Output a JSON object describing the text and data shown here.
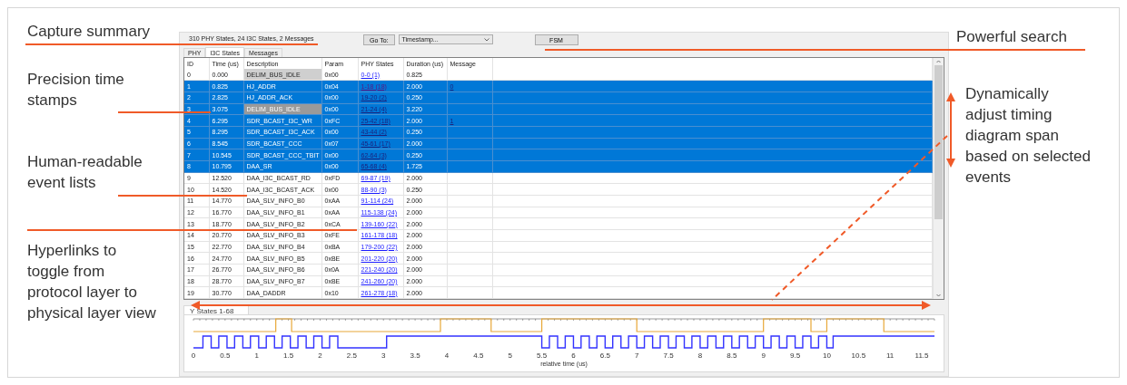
{
  "left_notes": [
    "Capture summary",
    "Precision time stamps",
    "Human-readable event lists",
    "Hyperlinks to toggle from protocol layer to physical layer view"
  ],
  "right_notes": [
    "Powerful search",
    "Dynamically adjust timing diagram span based on selected events"
  ],
  "summary": "310 PHY States, 24 I3C States, 2 Messages",
  "goto_button": "Go To:",
  "search_select": {
    "value": "Timestamp..."
  },
  "fsm_button": "FSM",
  "tabs": [
    {
      "label": "PHY",
      "selected": false
    },
    {
      "label": "I3C States",
      "selected": true
    },
    {
      "label": "Messages",
      "selected": false
    }
  ],
  "table": {
    "columns": [
      "ID",
      "Time (us)",
      "Description",
      "Param",
      "PHY States",
      "Duration (us)",
      "Message"
    ],
    "rows": [
      {
        "id": "0",
        "time": "0.000",
        "description": "DELIM_BUS_IDLE",
        "param": "0x00",
        "phy_states": "0-0 (1)",
        "duration": "0.825",
        "message": "",
        "selected": false,
        "focused": true,
        "visited": false
      },
      {
        "id": "1",
        "time": "0.825",
        "description": "HJ_ADDR",
        "param": "0x04",
        "phy_states": "1-18 (18)",
        "duration": "2.000",
        "message": "0",
        "selected": true,
        "focused": false,
        "visited": true
      },
      {
        "id": "2",
        "time": "2.825",
        "description": "HJ_ADDR_ACK",
        "param": "0x00",
        "phy_states": "19-20 (2)",
        "duration": "0.250",
        "message": "",
        "selected": true,
        "focused": false,
        "visited": false
      },
      {
        "id": "3",
        "time": "3.075",
        "description": "DELIM_BUS_IDLE",
        "param": "0x00",
        "phy_states": "21-24 (4)",
        "duration": "3.220",
        "message": "",
        "selected": true,
        "focused": true,
        "visited": false
      },
      {
        "id": "4",
        "time": "6.295",
        "description": "SDR_BCAST_I3C_WR",
        "param": "0xFC",
        "phy_states": "25-42 (18)",
        "duration": "2.000",
        "message": "1",
        "selected": true,
        "focused": false,
        "visited": false
      },
      {
        "id": "5",
        "time": "8.295",
        "description": "SDR_BCAST_I3C_ACK",
        "param": "0x00",
        "phy_states": "43-44 (2)",
        "duration": "0.250",
        "message": "",
        "selected": true,
        "focused": false,
        "visited": false
      },
      {
        "id": "6",
        "time": "8.545",
        "description": "SDR_BCAST_CCC",
        "param": "0x07",
        "phy_states": "45-61 (17)",
        "duration": "2.000",
        "message": "",
        "selected": true,
        "focused": false,
        "visited": false
      },
      {
        "id": "7",
        "time": "10.545",
        "description": "SDR_BCAST_CCC_TBIT",
        "param": "0x00",
        "phy_states": "62-64 (3)",
        "duration": "0.250",
        "message": "",
        "selected": true,
        "focused": false,
        "visited": false
      },
      {
        "id": "8",
        "time": "10.795",
        "description": "DAA_SR",
        "param": "0x00",
        "phy_states": "65-68 (4)",
        "duration": "1.725",
        "message": "",
        "selected": true,
        "focused": false,
        "visited": false
      },
      {
        "id": "9",
        "time": "12.520",
        "description": "DAA_I3C_BCAST_RD",
        "param": "0xFD",
        "phy_states": "69-87 (19)",
        "duration": "2.000",
        "message": "",
        "selected": false,
        "focused": false,
        "visited": false
      },
      {
        "id": "10",
        "time": "14.520",
        "description": "DAA_I3C_BCAST_ACK",
        "param": "0x00",
        "phy_states": "88-90 (3)",
        "duration": "0.250",
        "message": "",
        "selected": false,
        "focused": false,
        "visited": false
      },
      {
        "id": "11",
        "time": "14.770",
        "description": "DAA_SLV_INFO_B0",
        "param": "0xAA",
        "phy_states": "91-114 (24)",
        "duration": "2.000",
        "message": "",
        "selected": false,
        "focused": false,
        "visited": false
      },
      {
        "id": "12",
        "time": "16.770",
        "description": "DAA_SLV_INFO_B1",
        "param": "0xAA",
        "phy_states": "115-138 (24)",
        "duration": "2.000",
        "message": "",
        "selected": false,
        "focused": false,
        "visited": false
      },
      {
        "id": "13",
        "time": "18.770",
        "description": "DAA_SLV_INFO_B2",
        "param": "0xCA",
        "phy_states": "139-160 (22)",
        "duration": "2.000",
        "message": "",
        "selected": false,
        "focused": false,
        "visited": false
      },
      {
        "id": "14",
        "time": "20.770",
        "description": "DAA_SLV_INFO_B3",
        "param": "0xFE",
        "phy_states": "161-178 (18)",
        "duration": "2.000",
        "message": "",
        "selected": false,
        "focused": false,
        "visited": false
      },
      {
        "id": "15",
        "time": "22.770",
        "description": "DAA_SLV_INFO_B4",
        "param": "0xBA",
        "phy_states": "179-200 (22)",
        "duration": "2.000",
        "message": "",
        "selected": false,
        "focused": false,
        "visited": false
      },
      {
        "id": "16",
        "time": "24.770",
        "description": "DAA_SLV_INFO_B5",
        "param": "0xBE",
        "phy_states": "201-220 (20)",
        "duration": "2.000",
        "message": "",
        "selected": false,
        "focused": false,
        "visited": false
      },
      {
        "id": "17",
        "time": "26.770",
        "description": "DAA_SLV_INFO_B6",
        "param": "0x0A",
        "phy_states": "221-240 (20)",
        "duration": "2.000",
        "message": "",
        "selected": false,
        "focused": false,
        "visited": false
      },
      {
        "id": "18",
        "time": "28.770",
        "description": "DAA_SLV_INFO_B7",
        "param": "0xBE",
        "phy_states": "241-260 (20)",
        "duration": "2.000",
        "message": "",
        "selected": false,
        "focused": false,
        "visited": false
      },
      {
        "id": "19",
        "time": "30.770",
        "description": "DAA_DADDR",
        "param": "0x10",
        "phy_states": "261-278 (18)",
        "duration": "2.000",
        "message": "",
        "selected": false,
        "focused": false,
        "visited": false
      }
    ]
  },
  "waveform": {
    "tab_label": "Y States 1-68",
    "xticks": [
      "0",
      "0.5",
      "1",
      "1.5",
      "2",
      "2.5",
      "3",
      "3.5",
      "4",
      "4.5",
      "5",
      "5.5",
      "6",
      "6.5",
      "7",
      "7.5",
      "8",
      "8.5",
      "9",
      "9.5",
      "10",
      "10.5",
      "11",
      "11.5"
    ],
    "xlabel": "relative time (us)"
  }
}
